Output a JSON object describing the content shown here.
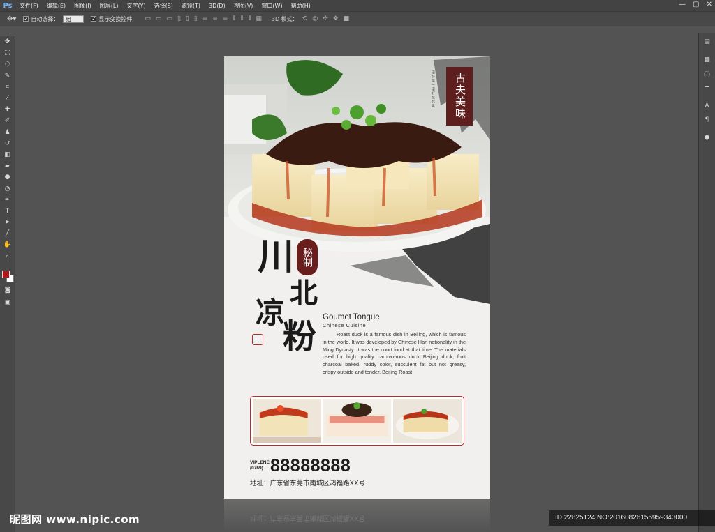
{
  "app": {
    "logo": "Ps",
    "menu": [
      "文件(F)",
      "编辑(E)",
      "图像(I)",
      "图层(L)",
      "文字(Y)",
      "选择(S)",
      "滤镜(T)",
      "3D(D)",
      "视图(V)",
      "窗口(W)",
      "帮助(H)"
    ],
    "window_controls": [
      "—",
      "▢",
      "✕"
    ]
  },
  "options_bar": {
    "auto_select_label": "自动选择：",
    "auto_select_value": "组",
    "show_transform_label": "显示变换控件",
    "mode_3d_label": "3D 模式："
  },
  "poster": {
    "seal_text": "古夫美味",
    "side_small_text": "一道好菜一道好菜文化",
    "mi_zhi": "秘制",
    "title_chars": [
      "川",
      "北",
      "凉",
      "粉"
    ],
    "en_title": "Goumet Tongue",
    "en_subtitle": "Chinese  Cuisine",
    "body": "Roast duck is a famous dish in Beijing, which is famous in the world. It was developed by Chinese Han nationality in the Ming Dynasty. It was the court food at that time. The materials used for high quality carnivo-rous duck Beijing duck, fruit charcoal baked, ruddy color, succulent fat but not greasy, crispy outside and tender. Beijing Roast",
    "vip_label": "VIPLENE",
    "area_code": "(0769)",
    "phone": "88888888",
    "address": "地址：广东省东莞市南城区鸿福路XX号",
    "colors": {
      "seal": "#5e1e1e",
      "accent_red": "#c0272d",
      "paper": "#f1f0ee"
    }
  },
  "footer": {
    "watermark": "昵图网 www.nipic.com",
    "image_id": "ID:22825124 NO:20160826155959343000"
  }
}
